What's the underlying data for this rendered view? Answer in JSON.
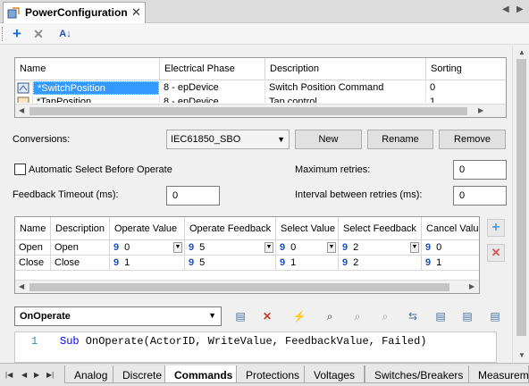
{
  "document_tab": {
    "title": "PowerConfiguration",
    "close": "✕"
  },
  "tab_nav": {
    "prev": "◀",
    "next": "▶"
  },
  "toolbar": {
    "add": "+",
    "delete": "✕",
    "sort": "A↓"
  },
  "positions_grid": {
    "columns": [
      "Name",
      "Electrical Phase",
      "Description",
      "Sorting"
    ],
    "rows": [
      [
        "*SwitchPosition",
        "8 - epDevice",
        "Switch Position Command",
        "0"
      ],
      [
        "*TapPosition",
        "8 - epDevice",
        "Tap control",
        "1"
      ]
    ]
  },
  "conversions": {
    "label": "Conversions:",
    "selected": "IEC61850_SBO",
    "new_label": "New",
    "rename_label": "Rename",
    "remove_label": "Remove"
  },
  "options": {
    "auto_select_label": "Automatic Select Before Operate",
    "auto_select_checked": false,
    "max_retries_label": "Maximum retries:",
    "max_retries_value": "0",
    "feedback_timeout_label": "Feedback Timeout (ms):",
    "feedback_timeout_value": "0",
    "interval_label": "Interval between retries (ms):",
    "interval_value": "0"
  },
  "values_grid": {
    "columns": [
      "Name",
      "Description",
      "Operate Value",
      "Operate Feedback",
      "Select Value",
      "Select Feedback",
      "Cancel Value"
    ],
    "rows": [
      {
        "name": "Open",
        "description": "Open",
        "operate_value": "0",
        "operate_feedback": "5",
        "select_value": "0",
        "select_feedback": "2",
        "cancel_value": "0"
      },
      {
        "name": "Close",
        "description": "Close",
        "operate_value": "1",
        "operate_feedback": "5",
        "select_value": "1",
        "select_feedback": "2",
        "cancel_value": "1"
      }
    ],
    "type_glyph": "9",
    "add_label": "+",
    "remove_label": "✕"
  },
  "script": {
    "event_selected": "OnOperate",
    "line_number": "1",
    "line_keyword": "Sub",
    "line_code": " OnOperate(ActorID, WriteValue, FeedbackValue, Failed)"
  },
  "bottom_tabs": [
    "Analog",
    "Discrete",
    "Commands",
    "Protections",
    "Voltages",
    "Switches/Breakers",
    "Measurements"
  ],
  "active_bottom_tab": "Commands",
  "colors": {
    "selection": "#3399ff",
    "accent_blue": "#1c4fbf",
    "remove_red": "#d9534f"
  }
}
